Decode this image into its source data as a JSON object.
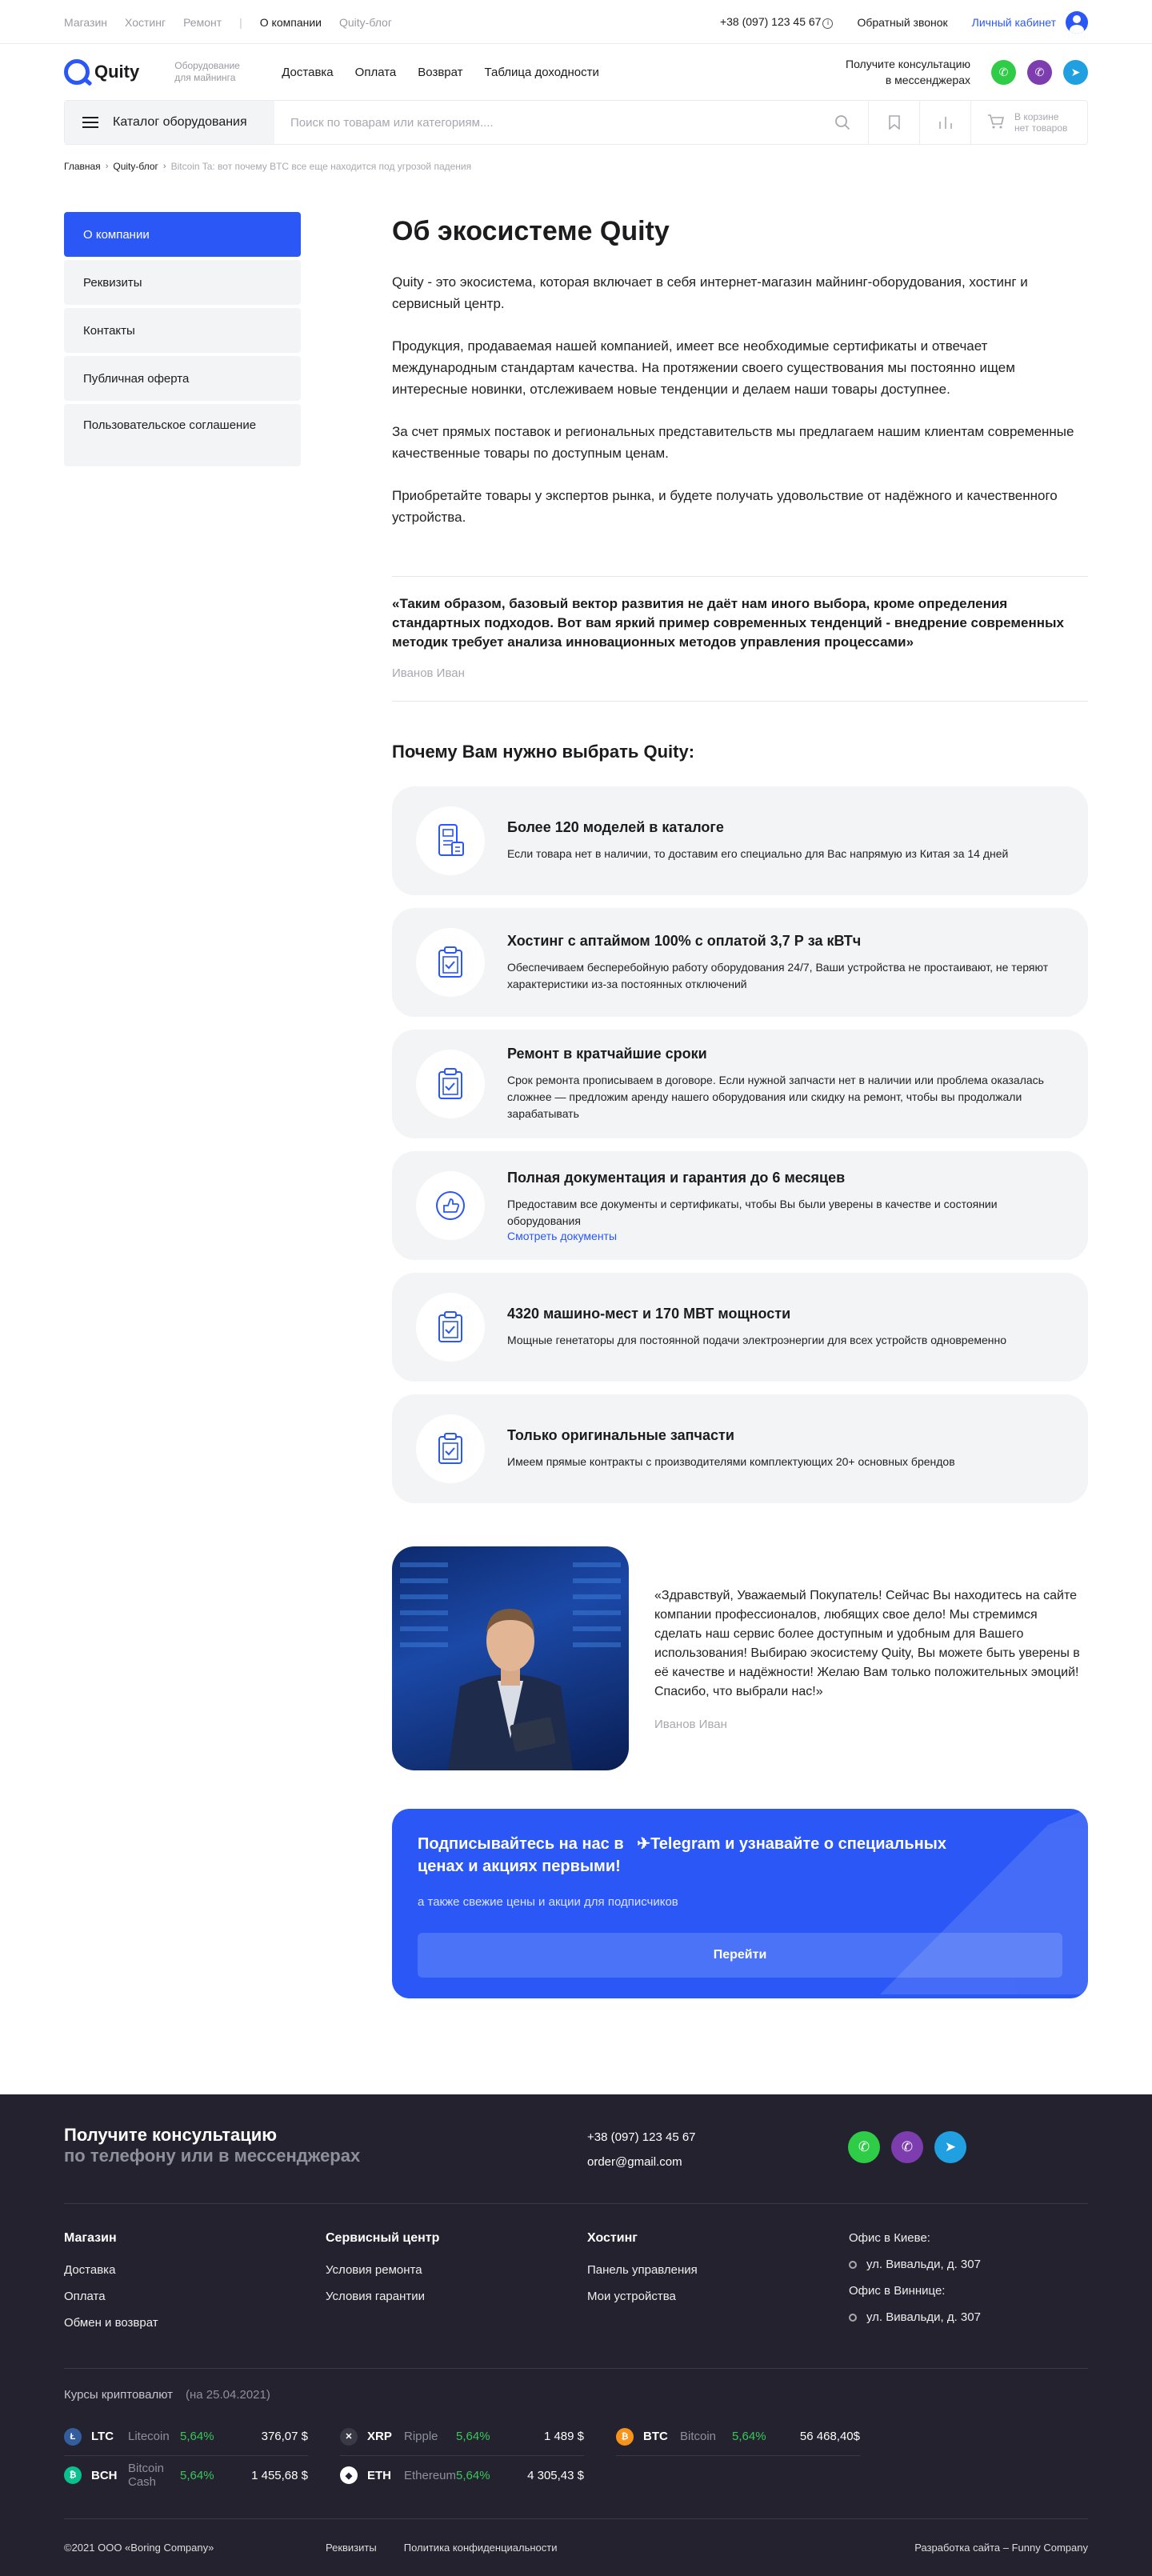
{
  "topbar": {
    "nav": [
      "Магазин",
      "Хостинг",
      "Ремонт",
      "О компании",
      "Quity-блог"
    ],
    "phone": "+38 (097) 123 45 67",
    "callback": "Обратный звонок",
    "cabinet": "Личный кабинет"
  },
  "header": {
    "logo": "Quity",
    "tagline": "Оборудование для майнинга",
    "nav": [
      "Доставка",
      "Оплата",
      "Возврат",
      "Таблица доходности"
    ],
    "consult_line1": "Получите консультацию",
    "consult_line2": "в мессенджерах"
  },
  "searchbar": {
    "catalog": "Каталог оборудования",
    "placeholder": "Поиск по товарам или категориям....",
    "cart_line1": "В корзине",
    "cart_line2": "нет товаров"
  },
  "breadcrumbs": [
    "Главная",
    "Quity-блог",
    "Bitcoin Ta: вот почему BTC все еще находится под угрозой падения"
  ],
  "sidebar": [
    "О компании",
    "Реквизиты",
    "Контакты",
    "Публичная оферта",
    "Пользовательское соглашение"
  ],
  "main": {
    "title": "Об экосистеме Quity",
    "paragraphs": [
      "Quity - это экосистема, которая включает в себя интернет-магазин майнинг-оборудования, хостинг и сервисный центр.",
      "Продукция, продаваемая нашей компанией, имеет все необходимые сертификаты и отвечает международным стандартам качества. На протяжении своего существования мы постоянно ищем интересные новинки, отслеживаем новые тенденции и делаем наши товары доступнее.",
      "За счет прямых поставок и региональных представительств мы предлагаем нашим клиентам современные качественные товары по доступным ценам.",
      "Приобретайте товары у экспертов рынка, и будете получать удовольствие от надёжного и качественного устройства."
    ],
    "quote": "«Таким образом, базовый вектор развития не даёт нам иного выбора, кроме определения стандартных подходов. Вот вам яркий пример современных тенденций - внедрение современных методик требует анализа инновационных методов управления процессами»",
    "quote_author": "Иванов Иван",
    "why_title": "Почему Вам нужно выбрать Quity:",
    "features": [
      {
        "title": "Более 120 моделей в каталоге",
        "desc": "Если товара нет в наличии, то доставим его специально для Вас напрямую из Китая за 14 дней",
        "icon": "catalog-icon"
      },
      {
        "title": "Хостинг с аптаймом 100% с оплатой 3,7 Р за кВТч",
        "desc": "Обеспечиваем бесперебойную работу оборудования 24/7, Ваши устройства не простаивают, не теряют характеристики из-за постоянных отключений",
        "icon": "checklist-icon"
      },
      {
        "title": "Ремонт в кратчайшие сроки",
        "desc": "Срок ремонта прописываем в договоре. Если нужной запчасти нет в наличии или проблема оказалась сложнее — предложим аренду нашего оборудования или скидку на ремонт, чтобы вы продолжали зарабатывать",
        "icon": "checklist-icon"
      },
      {
        "title": "Полная документация и гарантия до 6 месяцев",
        "desc": "Предоставим все документы и сертификаты, чтобы  Вы были уверены в качестве и состоянии оборудования",
        "link": "Смотреть документы",
        "icon": "thumbs-up-icon"
      },
      {
        "title": "4320 машино-мест и 170 МВТ мощности",
        "desc": "Мощные генетаторы для постоянной подачи электроэнергии для всех устройств одновременно",
        "icon": "checklist-icon"
      },
      {
        "title": "Только оригинальные запчасти",
        "desc": "Имеем прямые контракты с производителями комплектующих 20+ основных брендов",
        "icon": "checklist-icon"
      }
    ],
    "director_quote": "«Здравствуй, Уважаемый Покупатель! Сейчас Вы находитесь на сайте компании профессионалов, любящих свое дело! Мы стремимся сделать наш сервис более доступным и удобным для Вашего использования! Выбираю экосистему Quity, Вы можете быть уверены в её качестве и надёжности! Желаю Вам только положительных эмоций! Спасибо, что выбрали нас!»",
    "director_name": "Иванов Иван",
    "subscribe_title_1": "Подписывайтесь на нас в",
    "subscribe_tg": "Telegram",
    "subscribe_title_2": "и узнавайте о специальных ценах и акциях первыми!",
    "subscribe_sub": "а также свежие цены и акции для подписчиков",
    "subscribe_button": "Перейти"
  },
  "footer": {
    "consult_1": "Получите консультацию",
    "consult_2": "по телефону или в мессенджерах",
    "phone": "+38 (097) 123 45 67",
    "email": "order@gmail.com",
    "cols": [
      {
        "title": "Магазин",
        "links": [
          "Доставка",
          "Оплата",
          "Обмен и возврат"
        ]
      },
      {
        "title": "Сервисный центр",
        "links": [
          "Условия ремонта",
          "Условия гарантии"
        ]
      },
      {
        "title": "Хостинг",
        "links": [
          "Панель управления",
          "Мои устройства"
        ]
      }
    ],
    "office_kiev": "Офис в Киеве:",
    "office_kiev_addr": "ул. Вивальди, д. 307",
    "office_vin": "Офис в Виннице:",
    "office_vin_addr": "ул. Вивальди, д. 307",
    "rates_title": "Курсы криптовалют",
    "rates_date": "(на 25.04.2021)",
    "rates": [
      {
        "ticker": "LTC",
        "name": "Litecoin",
        "pct": "5,64%",
        "value": "376,07 $",
        "color": "#345d9d",
        "glyph": "Ł"
      },
      {
        "ticker": "XRP",
        "name": "Ripple",
        "pct": "5,64%",
        "value": "1 489 $",
        "color": "#3a3946",
        "glyph": "✕"
      },
      {
        "ticker": "BTC",
        "name": "Bitcoin",
        "pct": "5,64%",
        "value": "56 468,40$",
        "color": "#f7931a",
        "glyph": "₿"
      },
      {
        "ticker": "BCH",
        "name": "Bitcoin Cash",
        "pct": "5,64%",
        "value": "1 455,68 $",
        "color": "#0ac18e",
        "glyph": "₿"
      },
      {
        "ticker": "ETH",
        "name": "Ethereum",
        "pct": "5,64%",
        "value": "4 305,43 $",
        "color": "#ffffff",
        "glyph": "◆"
      }
    ],
    "copyright": "©2021 ООО «Boring Company»",
    "requisites": "Реквизиты",
    "privacy": "Политика конфиденциальности",
    "dev": "Разработка сайта – Funny Company"
  }
}
